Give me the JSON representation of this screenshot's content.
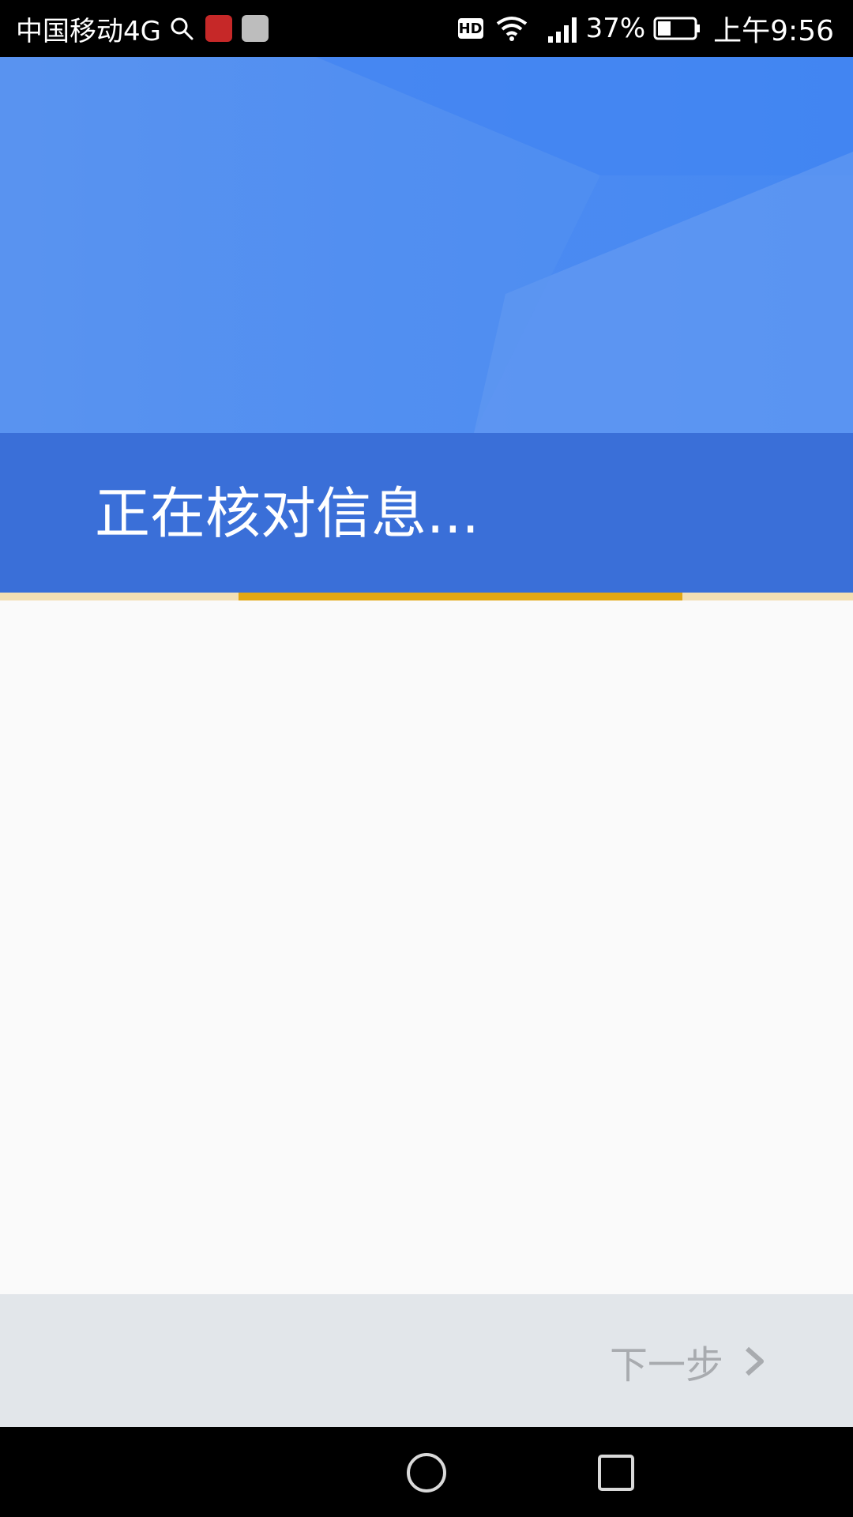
{
  "status_bar": {
    "carrier": "中国移动4G",
    "hd_badge": "HD",
    "battery_percent": "37%",
    "time": "上午9:56",
    "icons": [
      "search-icon",
      "app-notification-icon",
      "huawei-app-icon",
      "wifi-icon",
      "signal-4g-icon",
      "battery-icon"
    ]
  },
  "header": {
    "title": "正在核对信息...",
    "colors": {
      "top": "#4e8cf1",
      "band": "#3a6fd8"
    }
  },
  "progress": {
    "fraction_start": 0.28,
    "fraction_end": 0.8,
    "color": "#e3a712",
    "track_color": "#f3dfb4"
  },
  "footer": {
    "next_label": "下一步",
    "next_icon": "chevron-right-icon"
  },
  "nav_bar": {
    "icons": [
      "home-icon",
      "recents-icon"
    ]
  }
}
